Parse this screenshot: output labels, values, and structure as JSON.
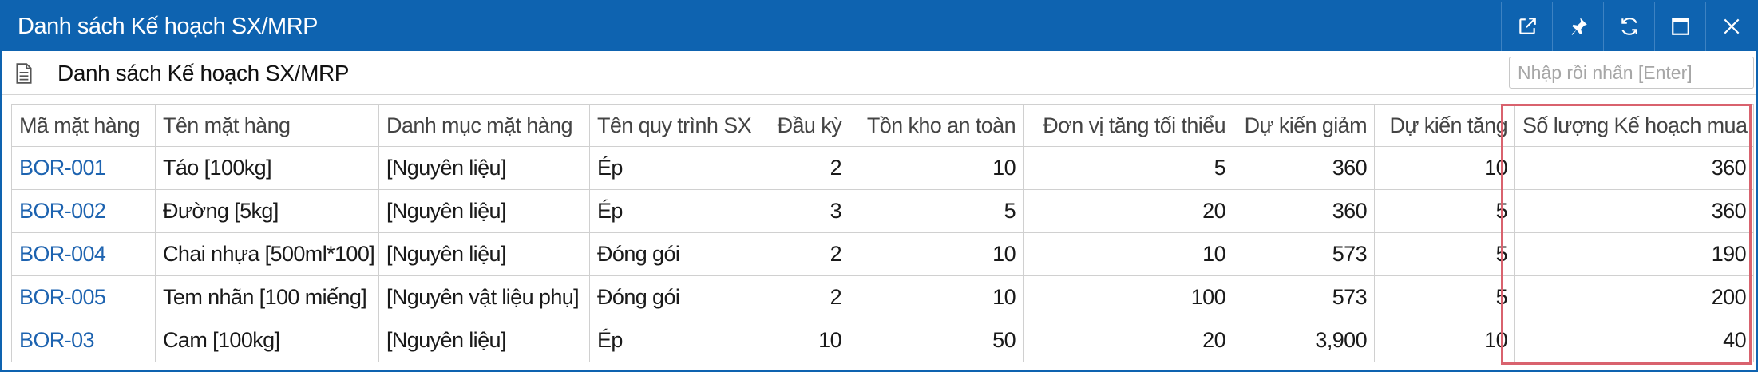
{
  "window": {
    "title": "Danh sách Kế hoạch SX/MRP",
    "buttons": [
      {
        "name": "open-external-icon"
      },
      {
        "name": "pin-icon"
      },
      {
        "name": "refresh-icon"
      },
      {
        "name": "maximize-icon"
      },
      {
        "name": "close-icon"
      }
    ]
  },
  "toolbar": {
    "title": "Danh sách Kế hoạch SX/MRP",
    "search_placeholder": "Nhập rồi nhấn [Enter]"
  },
  "table": {
    "columns": [
      "Mã mặt hàng",
      "Tên mặt hàng",
      "Danh mục mặt hàng",
      "Tên quy trình SX",
      "Đầu kỳ",
      "Tồn kho an toàn",
      "Đơn vị tăng tối thiểu",
      "Dự kiến giảm",
      "Dự kiến tăng",
      "Số lượng Kế hoạch mua"
    ],
    "rows": [
      [
        "BOR-001",
        "Táo [100kg]",
        "[Nguyên liệu]",
        "Ép",
        "2",
        "10",
        "5",
        "360",
        "10",
        "360"
      ],
      [
        "BOR-002",
        "Đường [5kg]",
        "[Nguyên liệu]",
        "Ép",
        "3",
        "5",
        "20",
        "360",
        "5",
        "360"
      ],
      [
        "BOR-004",
        "Chai nhựa [500ml*100]",
        "[Nguyên liệu]",
        "Đóng gói",
        "2",
        "10",
        "10",
        "573",
        "5",
        "190"
      ],
      [
        "BOR-005",
        "Tem nhãn [100 miếng]",
        "[Nguyên vật liệu phụ]",
        "Đóng gói",
        "2",
        "10",
        "100",
        "573",
        "5",
        "200"
      ],
      [
        "BOR-03",
        "Cam [100kg]",
        "[Nguyên liệu]",
        "Ép",
        "10",
        "50",
        "20",
        "3,900",
        "10",
        "40"
      ]
    ],
    "highlighted_column": "Số lượng Kế hoạch mua",
    "highlight_color": "#d9626e"
  },
  "colors": {
    "titlebar": "#0e63b0",
    "link": "#1d63b0"
  }
}
